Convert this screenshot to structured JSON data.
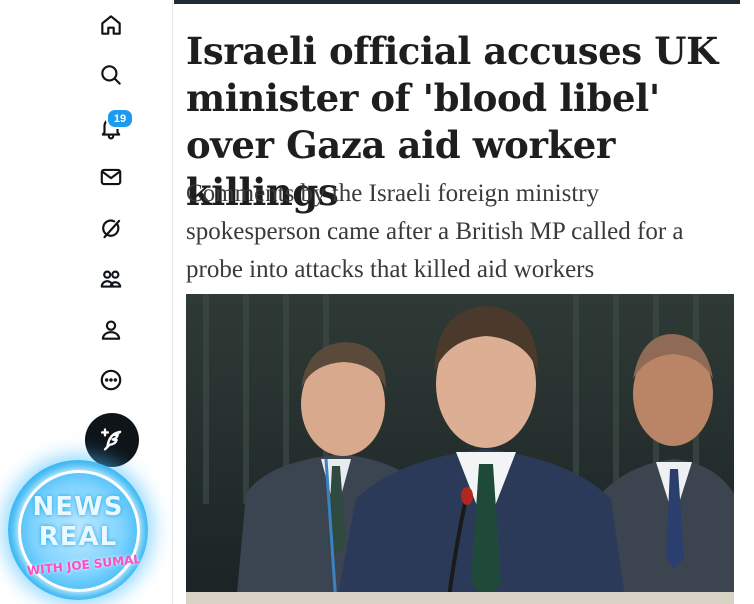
{
  "nav": {
    "items": [
      {
        "name": "home",
        "icon": "home-icon"
      },
      {
        "name": "explore",
        "icon": "search-icon"
      },
      {
        "name": "notifications",
        "icon": "bell-icon",
        "badge": "19"
      },
      {
        "name": "messages",
        "icon": "mail-icon"
      },
      {
        "name": "grok",
        "icon": "slash-circle-icon"
      },
      {
        "name": "communities",
        "icon": "people-icon"
      },
      {
        "name": "profile",
        "icon": "person-icon"
      },
      {
        "name": "more",
        "icon": "more-circle-icon"
      }
    ],
    "compose_icon": "feather-plus-icon"
  },
  "article": {
    "headline": "Israeli official accuses UK minister of 'blood libel' over Gaza aid worker killings",
    "standfirst": "Comments by the Israeli foreign ministry spokesperson came after a British MP called for a probe into attacks that killed aid workers",
    "accent_color": "#1e2b37"
  },
  "watermark": {
    "line1": "NEWS",
    "line2": "REAL",
    "line3": "WITH JOE SUMAL",
    "glow_color": "#39b7f2",
    "text_accent": "#ff4dc4"
  }
}
